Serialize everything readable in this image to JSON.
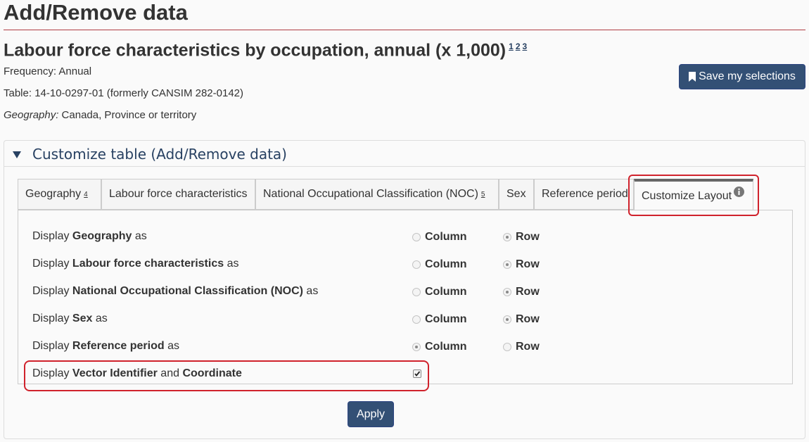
{
  "page": {
    "title": "Add/Remove data",
    "table_title": "Labour force characteristics by occupation, annual (x 1,000)",
    "footnotes": [
      "1",
      "2",
      "3"
    ],
    "frequency": "Frequency: Annual",
    "table_id": "Table: 14-10-0297-01 (formerly CANSIM 282-0142)",
    "geography_label": "Geography:",
    "geography_value": " Canada, Province or territory",
    "save_label": "Save my selections"
  },
  "panel": {
    "header": "Customize table (Add/Remove data)"
  },
  "tabs": [
    {
      "label": "Geography",
      "sup": "4"
    },
    {
      "label": "Labour force characteristics",
      "sup": ""
    },
    {
      "label": "National Occupational Classification (NOC)",
      "sup": "5"
    },
    {
      "label": "Sex",
      "sup": ""
    },
    {
      "label": "Reference period",
      "sup": ""
    },
    {
      "label": "Customize Layout",
      "sup": ""
    }
  ],
  "layout": {
    "display_prefix": "Display",
    "as_suffix": "as",
    "column_label": "Column",
    "row_label": "Row",
    "rows": [
      {
        "name": "Geography",
        "selected": "Row"
      },
      {
        "name": "Labour force characteristics",
        "selected": "Row"
      },
      {
        "name": "National Occupational Classification (NOC)",
        "selected": "Row"
      },
      {
        "name": "Sex",
        "selected": "Row"
      },
      {
        "name": "Reference period",
        "selected": "Column"
      }
    ],
    "vector": {
      "prefix": "Display",
      "part1": "Vector Identifier",
      "and": "and",
      "part2": "Coordinate",
      "checked": true
    }
  },
  "apply_label": "Apply",
  "colors": {
    "primary_button": "#335075",
    "highlight": "#d0222c",
    "link": "#284162"
  }
}
